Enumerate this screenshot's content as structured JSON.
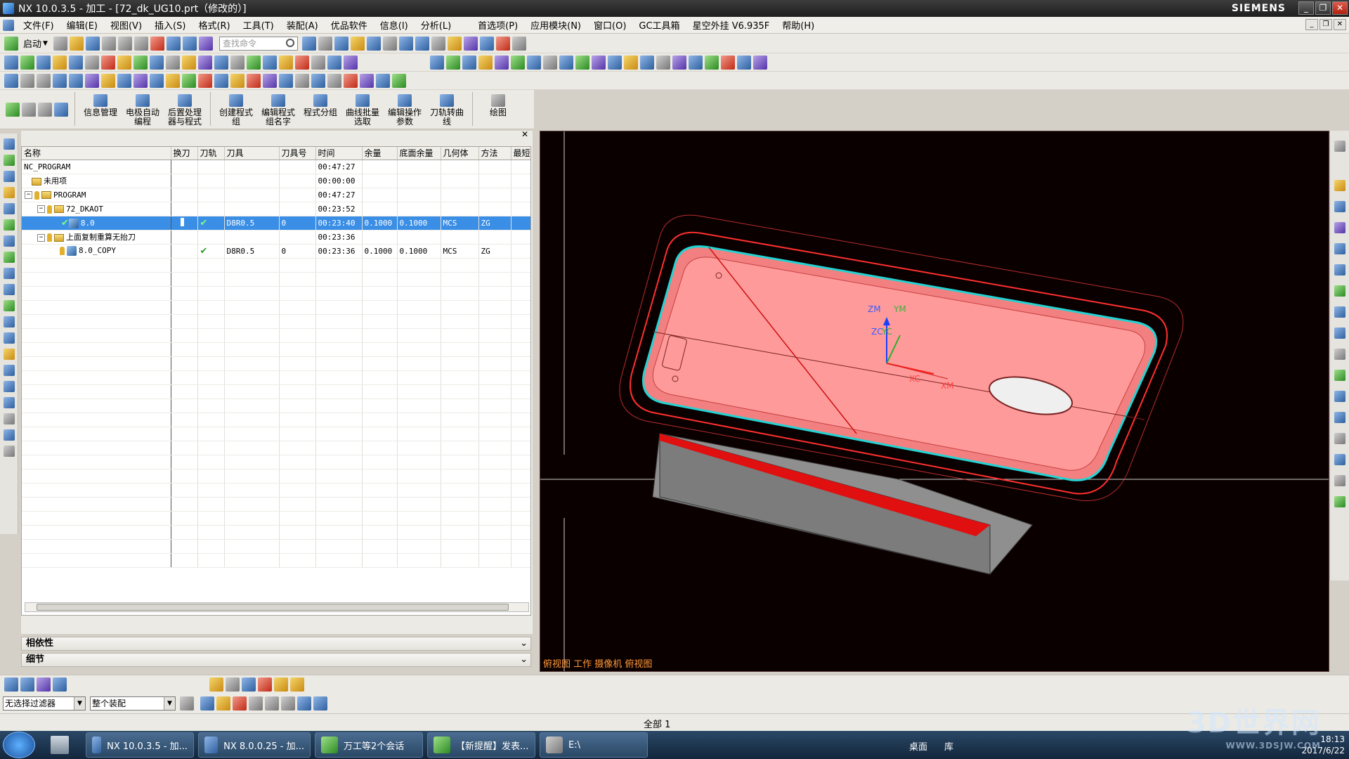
{
  "titlebar": {
    "title": "NX 10.0.3.5 - 加工 - [72_dk_UG10.prt（修改的）]",
    "brand": "SIEMENS"
  },
  "menu": [
    "文件(F)",
    "编辑(E)",
    "视图(V)",
    "插入(S)",
    "格式(R)",
    "工具(T)",
    "装配(A)",
    "优品软件",
    "信息(I)",
    "分析(L)",
    "首选项(P)",
    "应用模块(N)",
    "窗口(O)",
    "GC工具箱",
    "星空外挂 V6.935F",
    "帮助(H)"
  ],
  "toolbar1": {
    "start_label": "启动",
    "search_placeholder": "查找命令"
  },
  "ribbon": {
    "buttons": [
      "信息管理",
      "电极自动\n编程",
      "后置处理\n器与程式",
      "创建程式\n组",
      "编辑程式\n组名字",
      "程式分组",
      "曲线批量\n选取",
      "编辑操作\n参数",
      "刀轨转曲\n线",
      "绘图"
    ]
  },
  "table": {
    "headers": [
      "名称",
      "换刀",
      "刀轨",
      "刀具",
      "刀具号",
      "时间",
      "余量",
      "底面余量",
      "几何体",
      "方法",
      "最短"
    ],
    "rows": [
      {
        "name": "NC_PROGRAM",
        "toolchange": "",
        "path": "",
        "tool": "",
        "toolno": "",
        "time": "00:47:27",
        "stock": "",
        "floor": "",
        "geom": "",
        "method": "",
        "short": ""
      },
      {
        "name": "未用项",
        "toolchange": "",
        "path": "",
        "tool": "",
        "toolno": "",
        "time": "00:00:00",
        "stock": "",
        "floor": "",
        "geom": "",
        "method": "",
        "short": ""
      },
      {
        "name": "PROGRAM",
        "toolchange": "",
        "path": "",
        "tool": "",
        "toolno": "",
        "time": "00:47:27",
        "stock": "",
        "floor": "",
        "geom": "",
        "method": "",
        "short": ""
      },
      {
        "name": "72_DKAOT",
        "toolchange": "",
        "path": "",
        "tool": "",
        "toolno": "",
        "time": "00:23:52",
        "stock": "",
        "floor": "",
        "geom": "",
        "method": "",
        "short": ""
      },
      {
        "name": "8.0",
        "toolchange": "",
        "path": "✔",
        "tool": "D8R0.5",
        "toolno": "0",
        "time": "00:23:40",
        "stock": "0.1000",
        "floor": "0.1000",
        "geom": "MCS",
        "method": "ZG",
        "short": ""
      },
      {
        "name": "上面复制重算无抬刀",
        "toolchange": "",
        "path": "",
        "tool": "",
        "toolno": "",
        "time": "00:23:36",
        "stock": "",
        "floor": "",
        "geom": "",
        "method": "",
        "short": ""
      },
      {
        "name": "8.0_COPY",
        "toolchange": "",
        "path": "✔",
        "tool": "D8R0.5",
        "toolno": "0",
        "time": "00:23:36",
        "stock": "0.1000",
        "floor": "0.1000",
        "geom": "MCS",
        "method": "ZG",
        "short": ""
      }
    ]
  },
  "panels": {
    "dependency": "相依性",
    "details": "细节"
  },
  "viewport": {
    "label": "俯视图 工作 摄像机 俯视图",
    "axes": {
      "zm": "ZM",
      "ym": "YM",
      "zc": "ZC",
      "yc": "YC",
      "xc": "XC",
      "xm": "XM"
    }
  },
  "selectionbar": {
    "filter": "无选择过滤器",
    "scope": "整个装配"
  },
  "status": {
    "text": "全部 1"
  },
  "taskbar": {
    "items": [
      "NX 10.0.3.5 - 加...",
      "NX 8.0.0.25 - 加...",
      "万工等2个会话",
      "【新提醒】发表...",
      "E:\\"
    ],
    "desktop": "桌面",
    "library": "库",
    "time": "18:13",
    "date": "2017/6/22"
  },
  "watermark": {
    "text": "3D世界网",
    "url": "WWW.3DSJW.COM"
  }
}
